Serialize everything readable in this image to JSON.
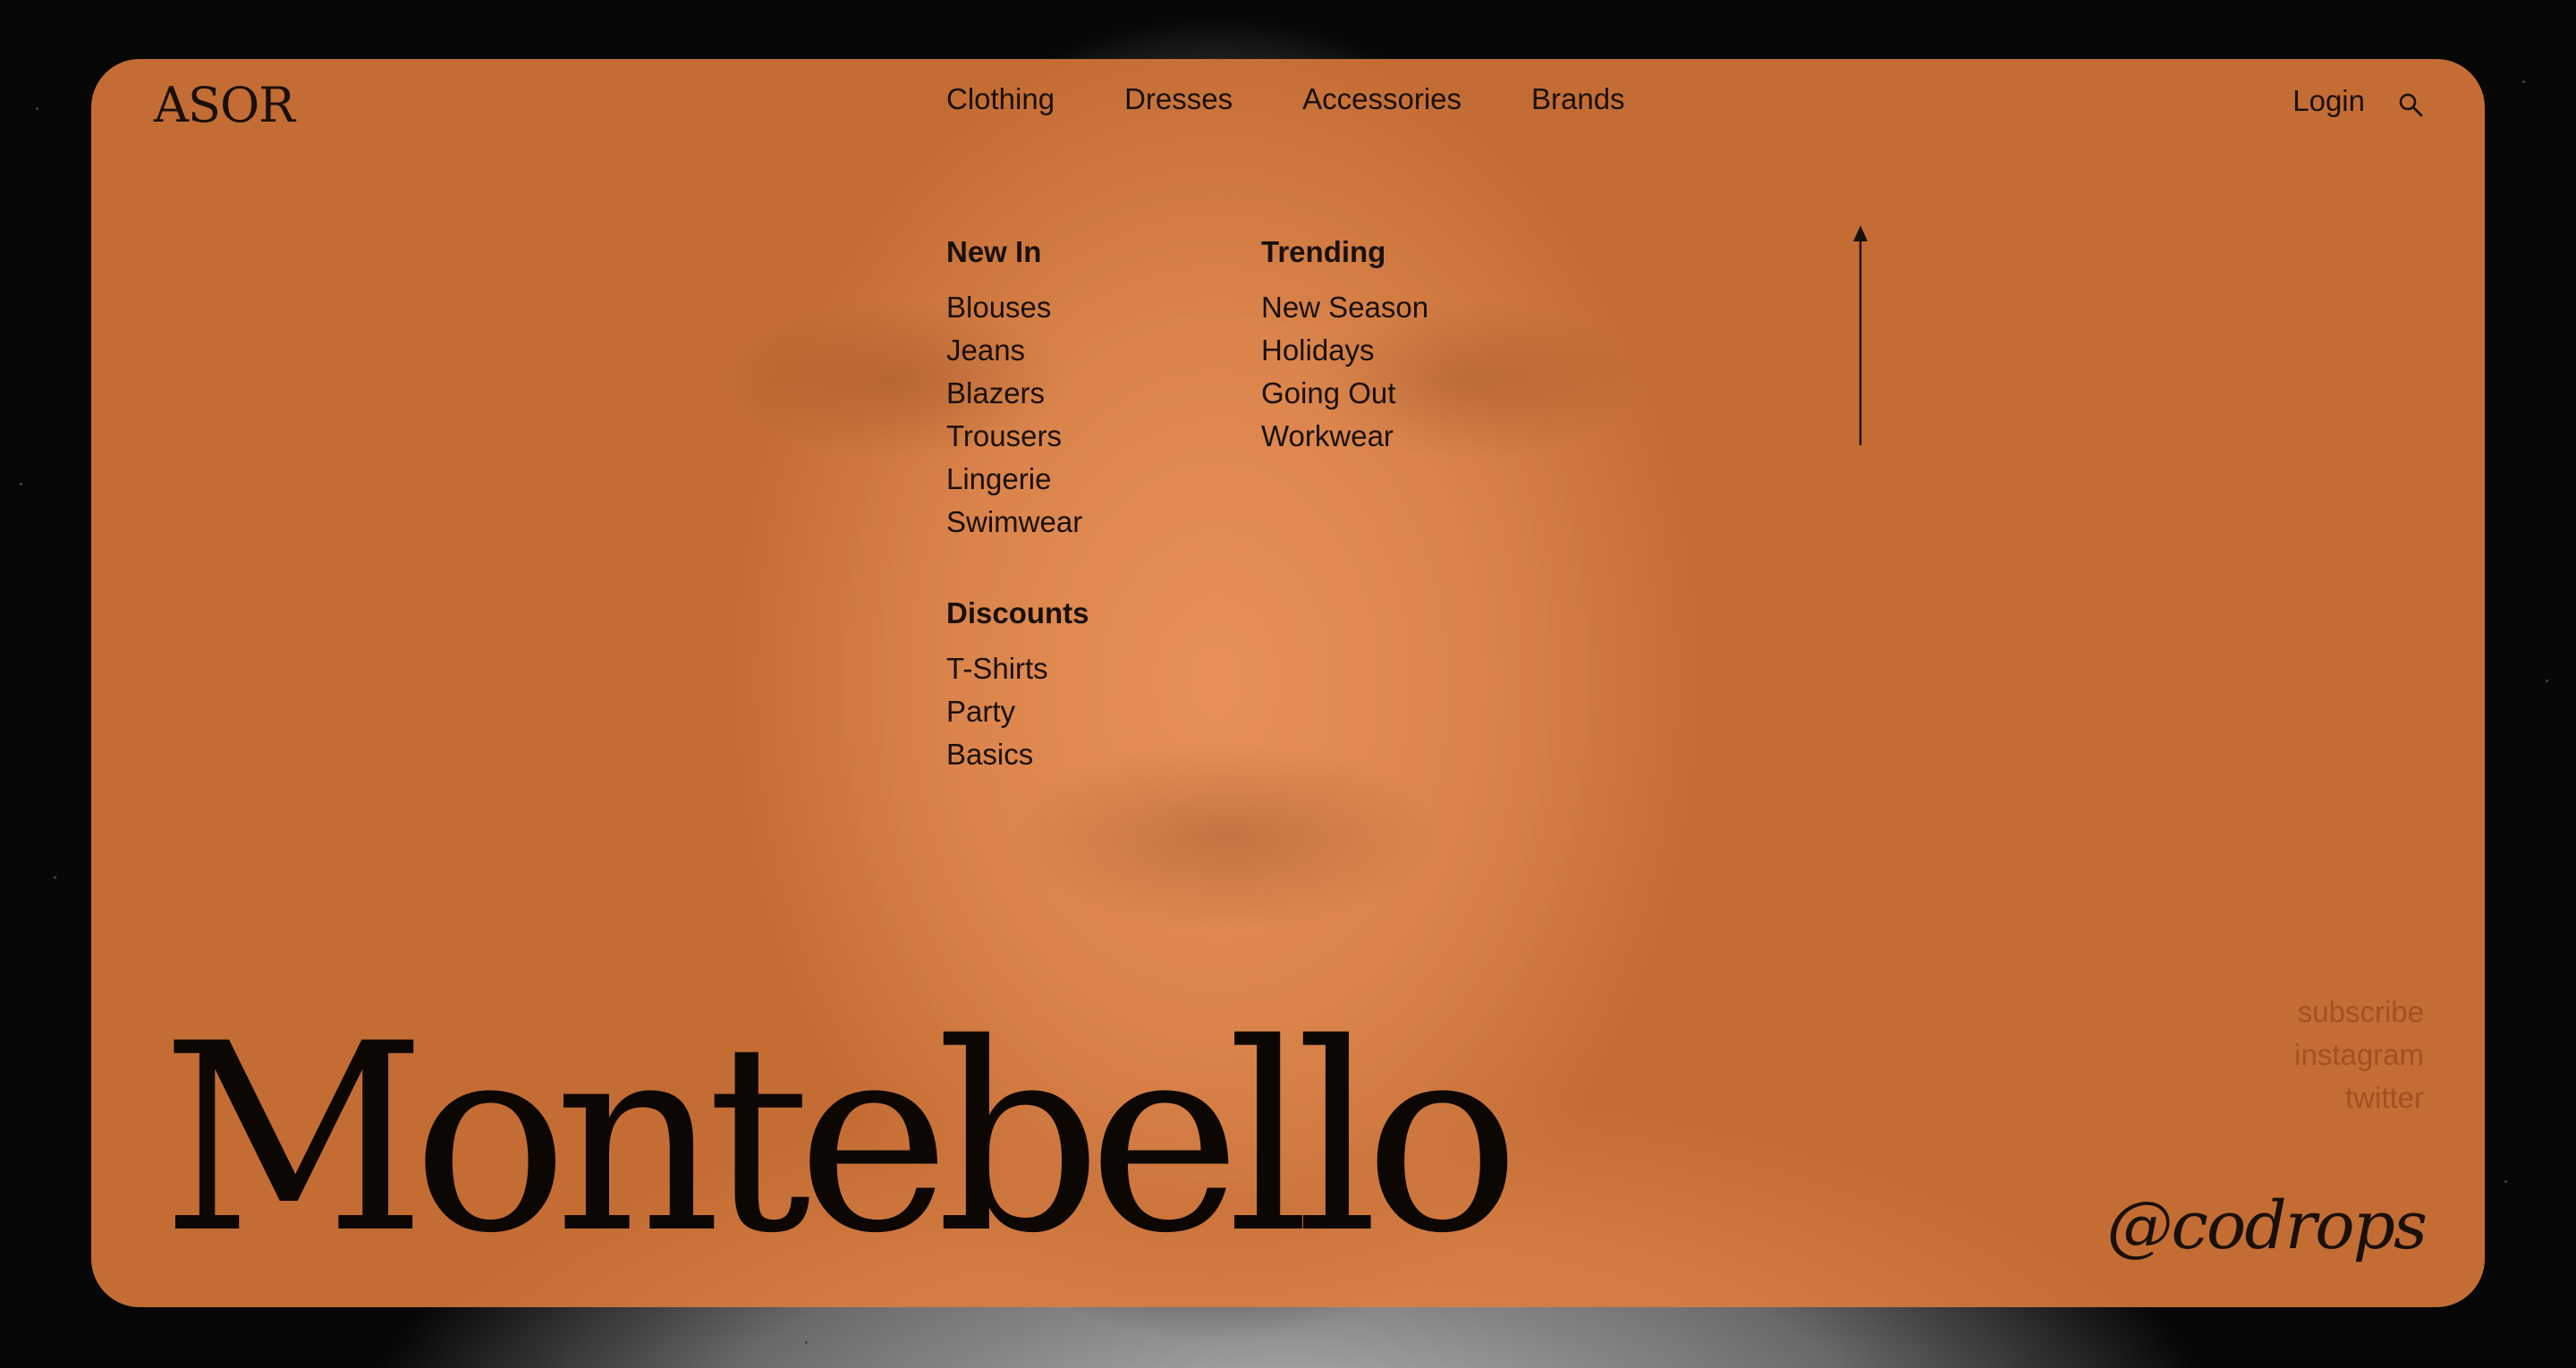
{
  "brand": {
    "logo": "ASOR"
  },
  "nav": {
    "items": [
      {
        "label": "Clothing"
      },
      {
        "label": "Dresses"
      },
      {
        "label": "Accessories"
      },
      {
        "label": "Brands"
      }
    ],
    "login_label": "Login",
    "search_icon": "search-icon"
  },
  "menu": {
    "new_in": {
      "heading": "New In",
      "items": [
        "Blouses",
        "Jeans",
        "Blazers",
        "Trousers",
        "Lingerie",
        "Swimwear"
      ]
    },
    "discounts": {
      "heading": "Discounts",
      "items": [
        "T-Shirts",
        "Party",
        "Basics"
      ]
    },
    "trending": {
      "heading": "Trending",
      "items": [
        "New Season",
        "Holidays",
        "Going Out",
        "Workwear"
      ]
    }
  },
  "decor": {
    "arrow_icon": "arrow-up-icon"
  },
  "social": {
    "links": [
      "subscribe",
      "instagram",
      "twitter"
    ]
  },
  "hero": {
    "title": "Montebello",
    "handle": "@codrops"
  },
  "colors": {
    "overlay": "#E27E3C",
    "text": "#1A100A",
    "muted_link": "#96481C",
    "background": "#070707"
  }
}
